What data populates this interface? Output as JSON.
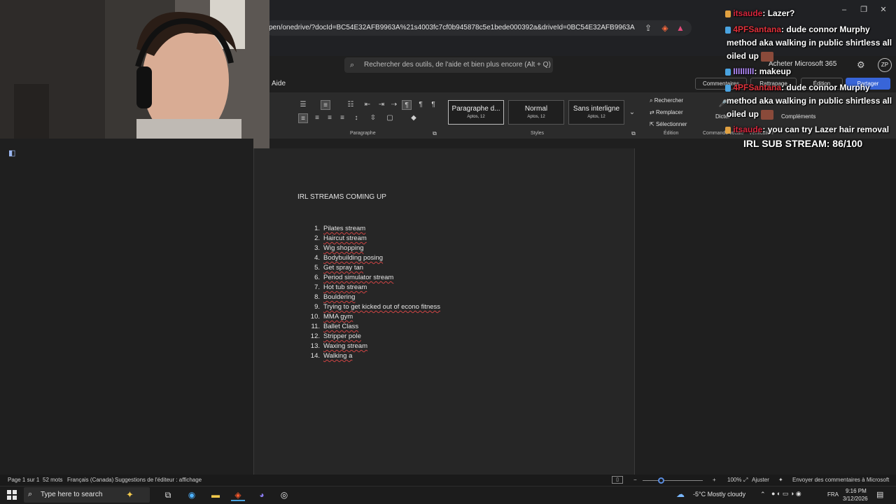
{
  "browser": {
    "url": "pen/onedrive/?docId=BC54E32AFB9963A%21s4003fc7cf0b945878c5e1bede000392a&driveId=0BC54E32AFB9963A",
    "window_controls": [
      "–",
      "❐",
      "✕"
    ]
  },
  "app_header": {
    "search_placeholder": "Rechercher des outils, de l'aide et bien plus encore (Alt + Q)",
    "buy_label": "Acheter Microsoft 365",
    "avatar_initials": "ZP"
  },
  "tabs": {
    "aide": "Aide",
    "comments": "Commentaires",
    "mode": "Rattrapage",
    "editing": "Édition",
    "share": "Partager"
  },
  "ribbon": {
    "paragraph_label": "Paragraphe",
    "styles_label": "Styles",
    "styles": [
      {
        "name": "Paragraphe d...",
        "font": "Aptos, 12"
      },
      {
        "name": "Normal",
        "font": "Aptos, 12"
      },
      {
        "name": "Sans interligne",
        "font": "Aptos, 12"
      }
    ],
    "editing": {
      "find": "Rechercher",
      "replace": "Remplacer",
      "select": "Sélectionner",
      "label": "Édition"
    },
    "dictate": "Dicter",
    "voice_label": "Commande vocale",
    "verification_label": "Vérification",
    "addins": "Compléments"
  },
  "document": {
    "title": "IRL STREAMS COMING UP",
    "items": [
      {
        "num": "1.",
        "text": "Pilates stream"
      },
      {
        "num": "2.",
        "text": "Haircut stream"
      },
      {
        "num": "3.",
        "text": "Wig shopping"
      },
      {
        "num": "4.",
        "text": "Bodybuilding posing"
      },
      {
        "num": "5.",
        "text": "Get spray tan"
      },
      {
        "num": "6.",
        "text": "Period simulator stream"
      },
      {
        "num": "7.",
        "text": "Hot tub stream"
      },
      {
        "num": "8.",
        "text": "Bouldering"
      },
      {
        "num": "9.",
        "text": "Trying to get kicked out of econo fitness"
      },
      {
        "num": "10.",
        "text": "MMA gym"
      },
      {
        "num": "11.",
        "text": "Ballet Class"
      },
      {
        "num": "12.",
        "text": "Stripper pole"
      },
      {
        "num": "13.",
        "text": "Waxing stream"
      },
      {
        "num": "14.",
        "text": "Walking a"
      }
    ]
  },
  "status_bar": {
    "page": "Page 1 sur 1",
    "words": "52 mots",
    "language": "Français (Canada)",
    "suggestions": "Suggestions de l'éditeur : affichage",
    "zoom": "100%",
    "fit": "Ajuster",
    "feedback": "Envoyer des commentaires à Microsoft"
  },
  "taskbar": {
    "search_placeholder": "Type here to search",
    "weather": "-5°C  Mostly cloudy",
    "lang": "FRA",
    "time": "9:16 PM",
    "date": "3/12/2026"
  },
  "chat": {
    "messages": [
      {
        "user": "itsaude",
        "text": ": Lazer?"
      },
      {
        "user": "4PFSantana",
        "text": ": dude connor Murphy"
      },
      {
        "user": "",
        "text": "method aka walking in public shirtless all"
      },
      {
        "user": "",
        "text": "oiled up"
      },
      {
        "user": "IIIIIIIII",
        "text": ": makeup"
      },
      {
        "user": "4PFSantana",
        "text": ": dude connor Murphy"
      },
      {
        "user": "",
        "text": "method aka walking in public shirtless all"
      },
      {
        "user": "",
        "text": "oiled up"
      },
      {
        "user": "itsaude",
        "text": ": you can try Lazer hair removal"
      }
    ],
    "sub_goal": "IRL SUB STREAM: 86/100"
  }
}
